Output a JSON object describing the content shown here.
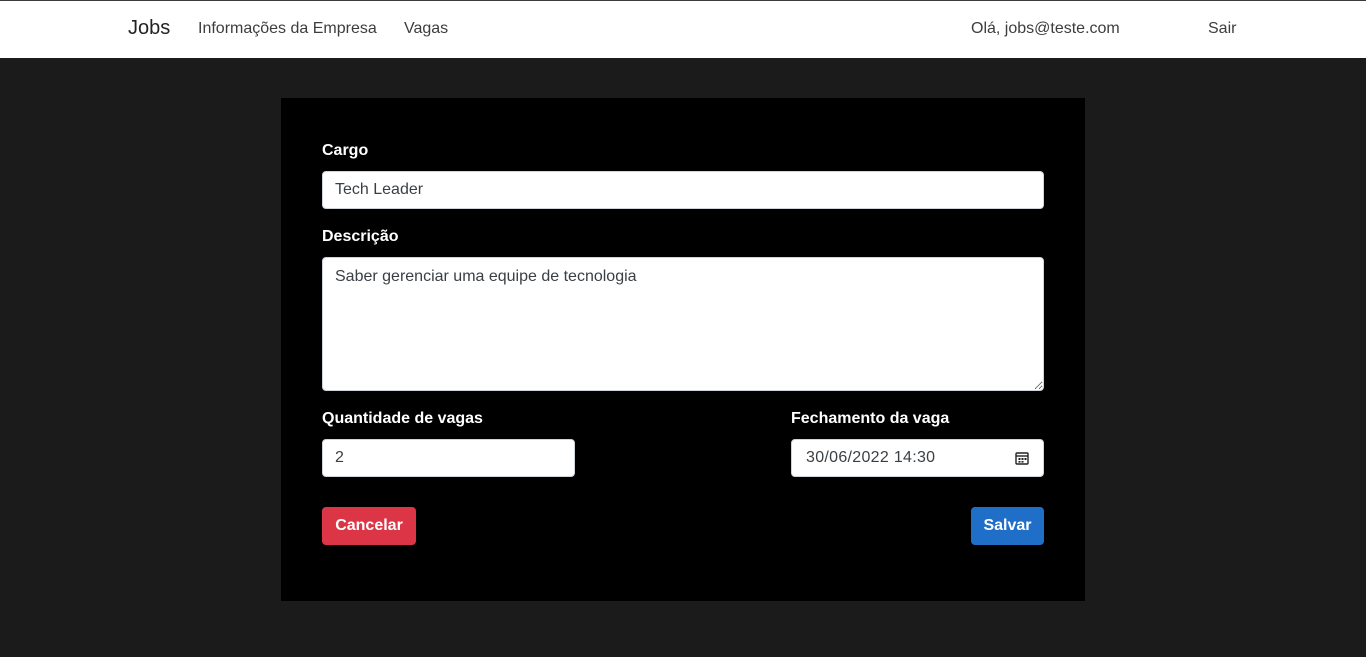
{
  "navbar": {
    "brand": "Jobs",
    "links": [
      "Informações da Empresa",
      "Vagas"
    ],
    "greeting": "Olá, jobs@teste.com",
    "logout": "Sair"
  },
  "form": {
    "cargo_label": "Cargo",
    "cargo_value": "Tech Leader",
    "descricao_label": "Descrição",
    "descricao_value": "Saber gerenciar uma equipe de tecnologia",
    "quantidade_label": "Quantidade de vagas",
    "quantidade_value": "2",
    "fechamento_label": "Fechamento da vaga",
    "fechamento_value": "30/06/2022 14:30",
    "cancel_label": "Cancelar",
    "save_label": "Salvar"
  },
  "colors": {
    "cancel": "#dc3545",
    "save": "#1f6fc9",
    "card": "#000000",
    "background": "#1c1b1c"
  },
  "icons": {
    "date_picker": "calendar-icon"
  }
}
